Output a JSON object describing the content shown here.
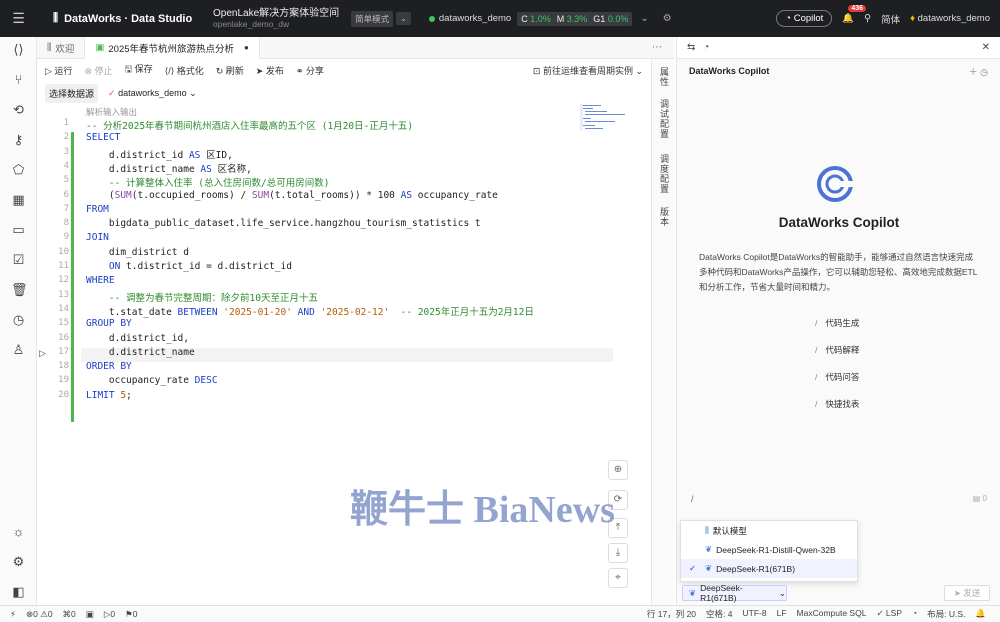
{
  "topbar": {
    "app": "DataWorks · Data Studio",
    "workspace_title": "OpenLake解决方案体验空间",
    "workspace_sub": "openlake_demo_dw",
    "mode": "简单模式",
    "mode_chevron": "⌄",
    "env": "dataworks_demo",
    "res_c": "C",
    "res_c_val": "1.0%",
    "res_m": "M",
    "res_m_val": "3.3%",
    "res_g": "G1",
    "res_g_val": "0.0%",
    "copilot": "Copilot",
    "notif_count": "436",
    "lang": "简体",
    "user": "dataworks_demo"
  },
  "tabs": [
    {
      "label": "欢迎"
    },
    {
      "label": "2025年春节杭州旅游热点分析"
    }
  ],
  "toolbar": {
    "run": "运行",
    "stop": "停止",
    "save": "保存",
    "format": "格式化",
    "refresh": "刷新",
    "publish": "发布",
    "share": "分享",
    "ops": "前往运维查看周期实例"
  },
  "datasource": {
    "label": "选择数据源",
    "value": "dataworks_demo"
  },
  "editor": {
    "outline_hint": "解析输入输出",
    "cursor_line": "17"
  },
  "right_strip": [
    "属性",
    "调试配置",
    "调度配置",
    "版本"
  ],
  "copilot": {
    "header": "DataWorks Copilot",
    "name": "DataWorks Copilot",
    "desc": "DataWorks Copilot是DataWorks的智能助手，能够通过自然语言快速完成多种代码和DataWorks产品操作，它可以辅助您轻松、高效地完成数据ETL和分析工作，节省大量时间和精力。",
    "suggestions": [
      "代码生成",
      "代码解释",
      "代码问答",
      "快捷找表"
    ],
    "input_prefix": "/",
    "input_count": "0",
    "models": [
      "默认模型",
      "DeepSeek-R1-Distill-Qwen-32B",
      "DeepSeek-R1(671B)"
    ],
    "selected_model": "DeepSeek-R1(671B)",
    "send": "发送"
  },
  "status": {
    "errors": "0",
    "warnings": "0",
    "w": "0",
    "d": "0",
    "f": "0",
    "pos": "行 17，列 20",
    "spaces": "空格: 4",
    "enc": "UTF-8",
    "eol": "LF",
    "lang": "MaxCompute SQL",
    "lsp": "LSP",
    "layout": "布局: U.S."
  },
  "watermark": "鞭牛士 BiaNews",
  "accent": "#1a3fc4"
}
